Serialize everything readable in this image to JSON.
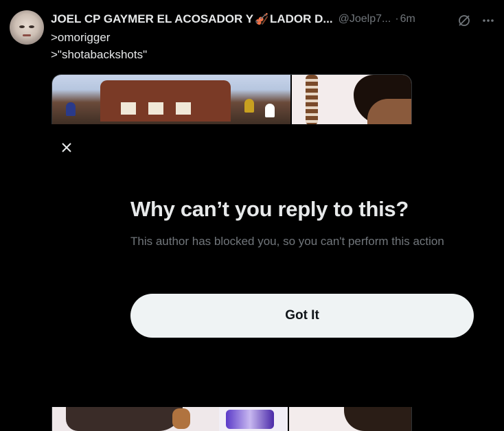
{
  "tweet": {
    "author_name": "JOEL CP GAYMER EL ACOSADOR Y",
    "author_name_suffix": "LADOR D...",
    "author_emoji_icon": "violin-icon",
    "author_handle": "@Joelp7...",
    "separator": "·",
    "timestamp": "6m",
    "text_lines": [
      ">omorigger",
      ">\"shotabackshots\""
    ],
    "media_count": 4
  },
  "modal": {
    "close_icon": "close-icon",
    "title": "Why can’t you reply to this?",
    "description": "This author has blocked you, so you can't perform this action",
    "button_label": "Got It"
  },
  "colors": {
    "background": "#000000",
    "primary_text": "#e7e9ea",
    "secondary_text": "#71767b",
    "button_bg": "#eff3f4",
    "button_text": "#0f1419"
  }
}
